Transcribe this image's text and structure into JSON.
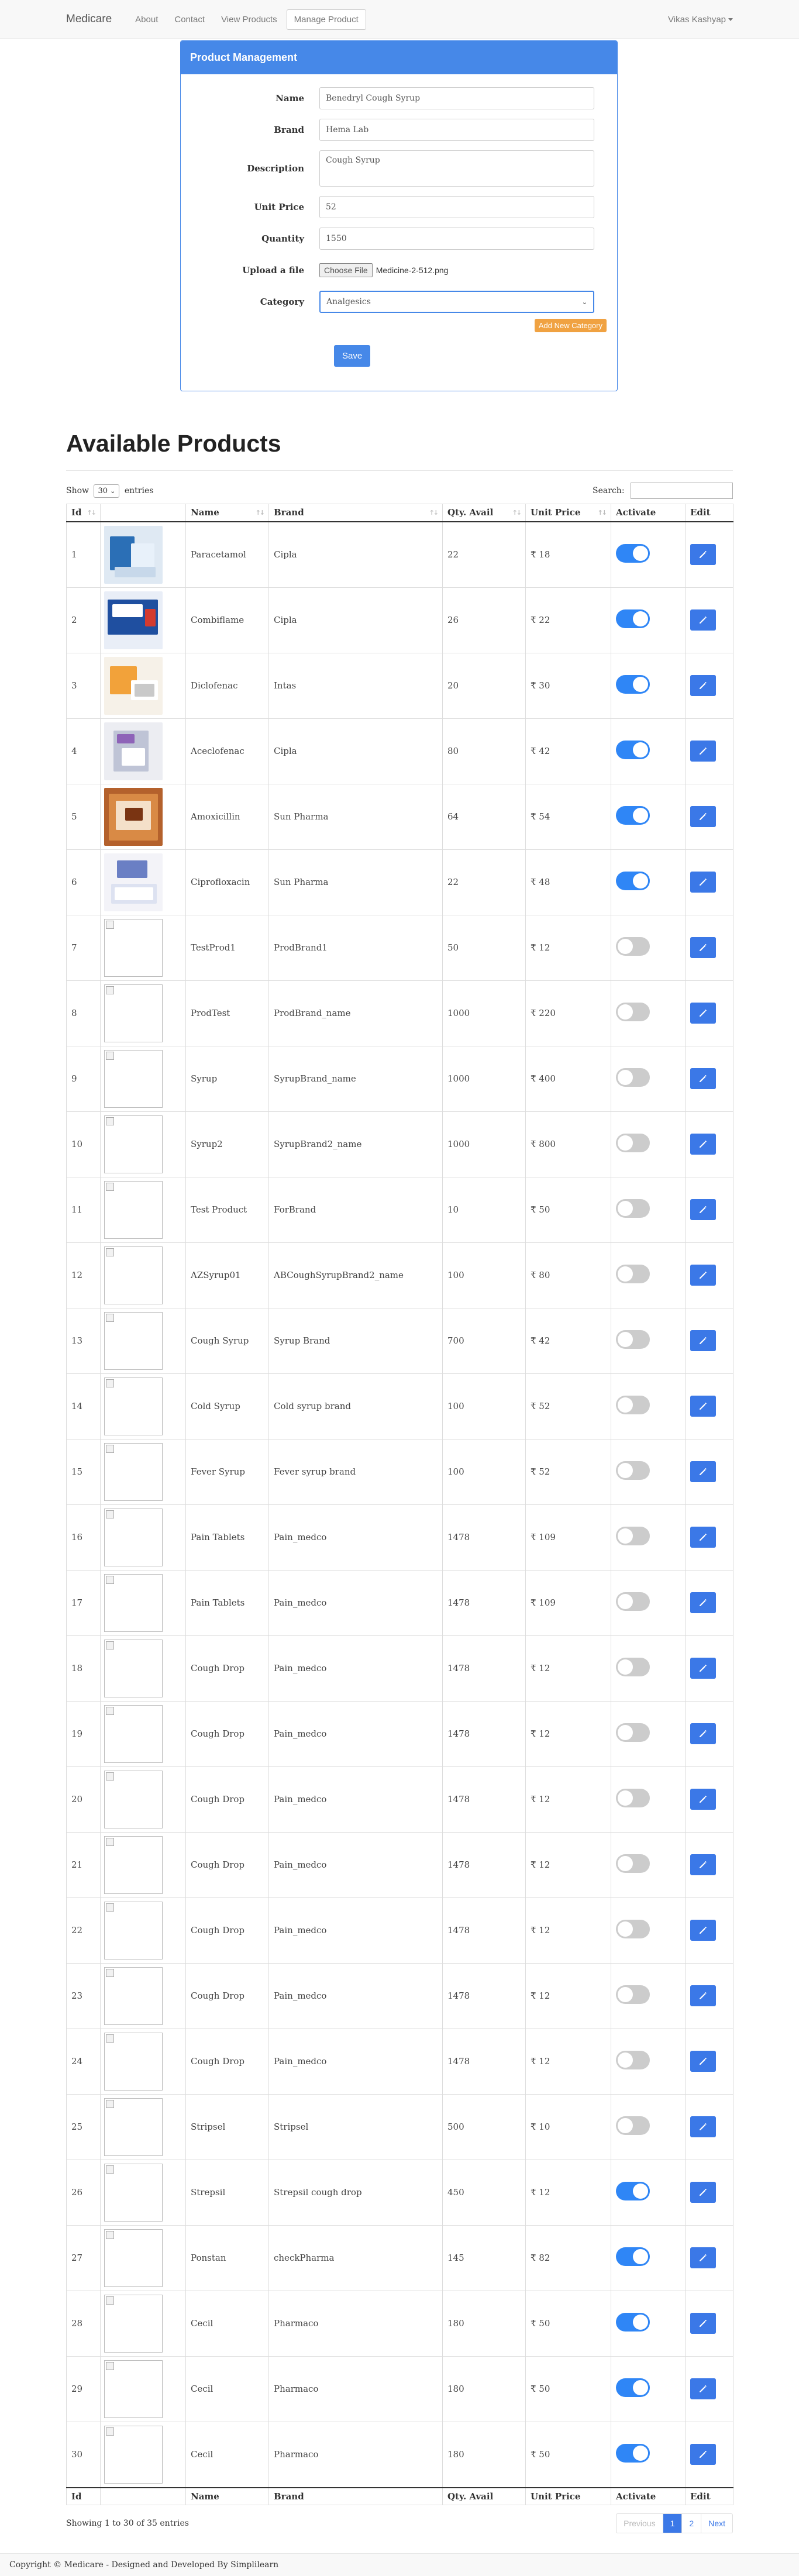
{
  "nav": {
    "brand": "Medicare",
    "links": [
      "About",
      "Contact",
      "View Products",
      "Manage Product"
    ],
    "user": "Vikas Kashyap"
  },
  "form": {
    "title": "Product Management",
    "name_label": "Name",
    "name_value": "Benedryl Cough Syrup",
    "brand_label": "Brand",
    "brand_value": "Hema Lab",
    "description_label": "Description",
    "description_value": "Cough Syrup",
    "price_label": "Unit Price",
    "price_value": "52",
    "quantity_label": "Quantity",
    "quantity_value": "1550",
    "file_label": "Upload a file",
    "file_button": "Choose File",
    "file_name": "Medicine-2-512.png",
    "category_label": "Category",
    "category_value": "Analgesics",
    "add_category": "Add New Category",
    "save": "Save"
  },
  "products": {
    "heading": "Available Products",
    "show_label": "Show",
    "entries_value": "30",
    "entries_label": "entries",
    "search_label": "Search:",
    "columns": [
      "Id",
      "",
      "Name",
      "Brand",
      "Qty. Avail",
      "Unit Price",
      "Activate",
      "Edit"
    ],
    "rows": [
      {
        "id": "1",
        "name": "Paracetamol",
        "brand": "Cipla",
        "qty": "22",
        "price": "₹ 18",
        "active": true,
        "img": "pic1"
      },
      {
        "id": "2",
        "name": "Combiflame",
        "brand": "Cipla",
        "qty": "26",
        "price": "₹ 22",
        "active": true,
        "img": "pic2"
      },
      {
        "id": "3",
        "name": "Diclofenac",
        "brand": "Intas",
        "qty": "20",
        "price": "₹ 30",
        "active": true,
        "img": "pic3"
      },
      {
        "id": "4",
        "name": "Aceclofenac",
        "brand": "Cipla",
        "qty": "80",
        "price": "₹ 42",
        "active": true,
        "img": "pic4"
      },
      {
        "id": "5",
        "name": "Amoxicillin",
        "brand": "Sun Pharma",
        "qty": "64",
        "price": "₹ 54",
        "active": true,
        "img": "pic5"
      },
      {
        "id": "6",
        "name": "Ciprofloxacin",
        "brand": "Sun Pharma",
        "qty": "22",
        "price": "₹ 48",
        "active": true,
        "img": "pic6"
      },
      {
        "id": "7",
        "name": "TestProd1",
        "brand": "ProdBrand1",
        "qty": "50",
        "price": "₹ 12",
        "active": false,
        "img": "broken"
      },
      {
        "id": "8",
        "name": "ProdTest",
        "brand": "ProdBrand_name",
        "qty": "1000",
        "price": "₹ 220",
        "active": false,
        "img": "broken"
      },
      {
        "id": "9",
        "name": "Syrup",
        "brand": "SyrupBrand_name",
        "qty": "1000",
        "price": "₹ 400",
        "active": false,
        "img": "broken"
      },
      {
        "id": "10",
        "name": "Syrup2",
        "brand": "SyrupBrand2_name",
        "qty": "1000",
        "price": "₹ 800",
        "active": false,
        "img": "broken"
      },
      {
        "id": "11",
        "name": "Test Product",
        "brand": "ForBrand",
        "qty": "10",
        "price": "₹ 50",
        "active": false,
        "img": "broken"
      },
      {
        "id": "12",
        "name": "AZSyrup01",
        "brand": "ABCoughSyrupBrand2_name",
        "qty": "100",
        "price": "₹ 80",
        "active": false,
        "img": "broken"
      },
      {
        "id": "13",
        "name": "Cough Syrup",
        "brand": "Syrup Brand",
        "qty": "700",
        "price": "₹ 42",
        "active": false,
        "img": "broken"
      },
      {
        "id": "14",
        "name": "Cold Syrup",
        "brand": "Cold syrup brand",
        "qty": "100",
        "price": "₹ 52",
        "active": false,
        "img": "broken"
      },
      {
        "id": "15",
        "name": "Fever Syrup",
        "brand": "Fever syrup brand",
        "qty": "100",
        "price": "₹ 52",
        "active": false,
        "img": "broken"
      },
      {
        "id": "16",
        "name": "Pain Tablets",
        "brand": "Pain_medco",
        "qty": "1478",
        "price": "₹ 109",
        "active": false,
        "img": "broken"
      },
      {
        "id": "17",
        "name": "Pain Tablets",
        "brand": "Pain_medco",
        "qty": "1478",
        "price": "₹ 109",
        "active": false,
        "img": "broken"
      },
      {
        "id": "18",
        "name": "Cough Drop",
        "brand": "Pain_medco",
        "qty": "1478",
        "price": "₹ 12",
        "active": false,
        "img": "broken"
      },
      {
        "id": "19",
        "name": "Cough Drop",
        "brand": "Pain_medco",
        "qty": "1478",
        "price": "₹ 12",
        "active": false,
        "img": "broken"
      },
      {
        "id": "20",
        "name": "Cough Drop",
        "brand": "Pain_medco",
        "qty": "1478",
        "price": "₹ 12",
        "active": false,
        "img": "broken"
      },
      {
        "id": "21",
        "name": "Cough Drop",
        "brand": "Pain_medco",
        "qty": "1478",
        "price": "₹ 12",
        "active": false,
        "img": "broken"
      },
      {
        "id": "22",
        "name": "Cough Drop",
        "brand": "Pain_medco",
        "qty": "1478",
        "price": "₹ 12",
        "active": false,
        "img": "broken"
      },
      {
        "id": "23",
        "name": "Cough Drop",
        "brand": "Pain_medco",
        "qty": "1478",
        "price": "₹ 12",
        "active": false,
        "img": "broken"
      },
      {
        "id": "24",
        "name": "Cough Drop",
        "brand": "Pain_medco",
        "qty": "1478",
        "price": "₹ 12",
        "active": false,
        "img": "broken"
      },
      {
        "id": "25",
        "name": "Stripsel",
        "brand": "Stripsel",
        "qty": "500",
        "price": "₹ 10",
        "active": false,
        "img": "broken"
      },
      {
        "id": "26",
        "name": "Strepsil",
        "brand": "Strepsil cough drop",
        "qty": "450",
        "price": "₹ 12",
        "active": true,
        "img": "broken"
      },
      {
        "id": "27",
        "name": "Ponstan",
        "brand": "checkPharma",
        "qty": "145",
        "price": "₹ 82",
        "active": true,
        "img": "broken"
      },
      {
        "id": "28",
        "name": "Cecil",
        "brand": "Pharmaco",
        "qty": "180",
        "price": "₹ 50",
        "active": true,
        "img": "broken"
      },
      {
        "id": "29",
        "name": "Cecil",
        "brand": "Pharmaco",
        "qty": "180",
        "price": "₹ 50",
        "active": true,
        "img": "broken"
      },
      {
        "id": "30",
        "name": "Cecil",
        "brand": "Pharmaco",
        "qty": "180",
        "price": "₹ 50",
        "active": true,
        "img": "broken"
      }
    ],
    "info": "Showing 1 to 30 of 35 entries",
    "pager": [
      "Previous",
      "1",
      "2",
      "Next"
    ]
  },
  "footer": "Copyright © Medicare - Designed and Developed By Simplilearn",
  "colors": {
    "accent": "#4688e8",
    "warning": "#f0a242",
    "toggle_on": "#2f86f6",
    "toggle_off": "#cccccc"
  },
  "icons": {
    "edit": "pencil-icon",
    "sort": "sort-icon",
    "dropdown": "caret-down-icon"
  }
}
